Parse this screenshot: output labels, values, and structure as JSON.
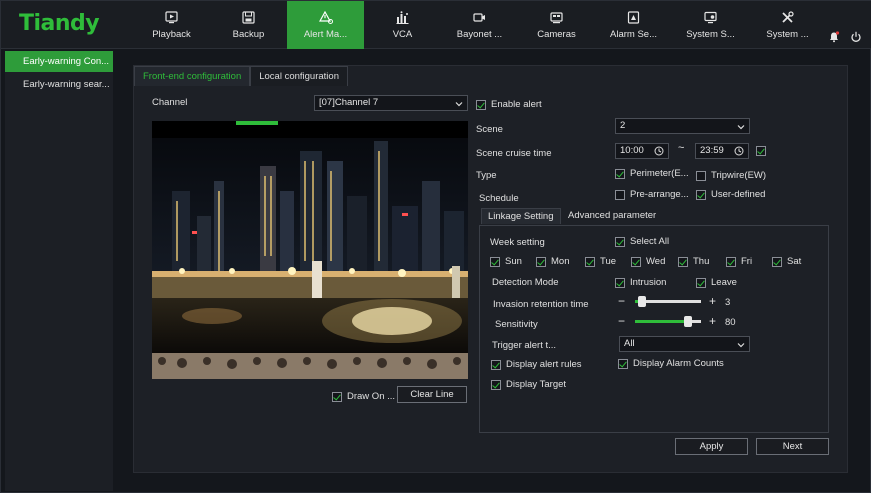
{
  "brand": {
    "logo": "Tiandy"
  },
  "nav": [
    {
      "label": "Playback",
      "icon": "playback-icon"
    },
    {
      "label": "Backup",
      "icon": "backup-icon"
    },
    {
      "label": "Alert Ma...",
      "icon": "alert-icon"
    },
    {
      "label": "VCA",
      "icon": "vca-icon"
    },
    {
      "label": "Bayonet ...",
      "icon": "bayonet-icon"
    },
    {
      "label": "Cameras",
      "icon": "cameras-icon"
    },
    {
      "label": "Alarm Se...",
      "icon": "alarm-icon"
    },
    {
      "label": "System S...",
      "icon": "system-status-icon"
    },
    {
      "label": "System ...",
      "icon": "system-tools-icon"
    }
  ],
  "sidebar": {
    "items": [
      {
        "label": "Early-warning Con..."
      },
      {
        "label": "Early-warning sear..."
      }
    ]
  },
  "tabs": {
    "front_end": "Front-end configuration",
    "local": "Local configuration"
  },
  "form": {
    "channel_label": "Channel",
    "channel_value": "[07]Channel 7",
    "enable_alert": "Enable alert",
    "scene_label": "Scene",
    "scene_value": "2",
    "cruise_label": "Scene cruise time",
    "cruise_start": "10:00",
    "cruise_tilde": "~",
    "cruise_end": "23:59",
    "type_label": "Type",
    "type_perimeter": "Perimeter(E...",
    "type_tripwire": "Tripwire(EW)",
    "schedule_label": "Schedule",
    "schedule_prearrange": "Pre-arrange...",
    "schedule_user": "User-defined"
  },
  "subtabs": {
    "linkage": "Linkage Setting",
    "advanced": "Advanced parameter"
  },
  "linkage": {
    "week_label": "Week setting",
    "select_all": "Select All",
    "days": [
      "Sun",
      "Mon",
      "Tue",
      "Wed",
      "Thu",
      "Fri",
      "Sat"
    ],
    "detection_label": "Detection Mode",
    "intrusion": "Intrusion",
    "leave": "Leave",
    "retention_label": "Invasion retention time",
    "retention_value": "3",
    "sensitivity_label": "Sensitivity",
    "sensitivity_value": "80",
    "trigger_label": "Trigger alert t...",
    "trigger_value": "All",
    "display_rules": "Display alert rules",
    "display_counts": "Display Alarm Counts",
    "display_target": "Display Target"
  },
  "video_controls": {
    "draw_on": "Draw On ...",
    "clear_line": "Clear Line"
  },
  "actions": {
    "apply": "Apply",
    "next": "Next"
  },
  "colors": {
    "accent": "#2e9c3a",
    "accent_text": "#2fbd3a",
    "bg": "#14171c"
  }
}
